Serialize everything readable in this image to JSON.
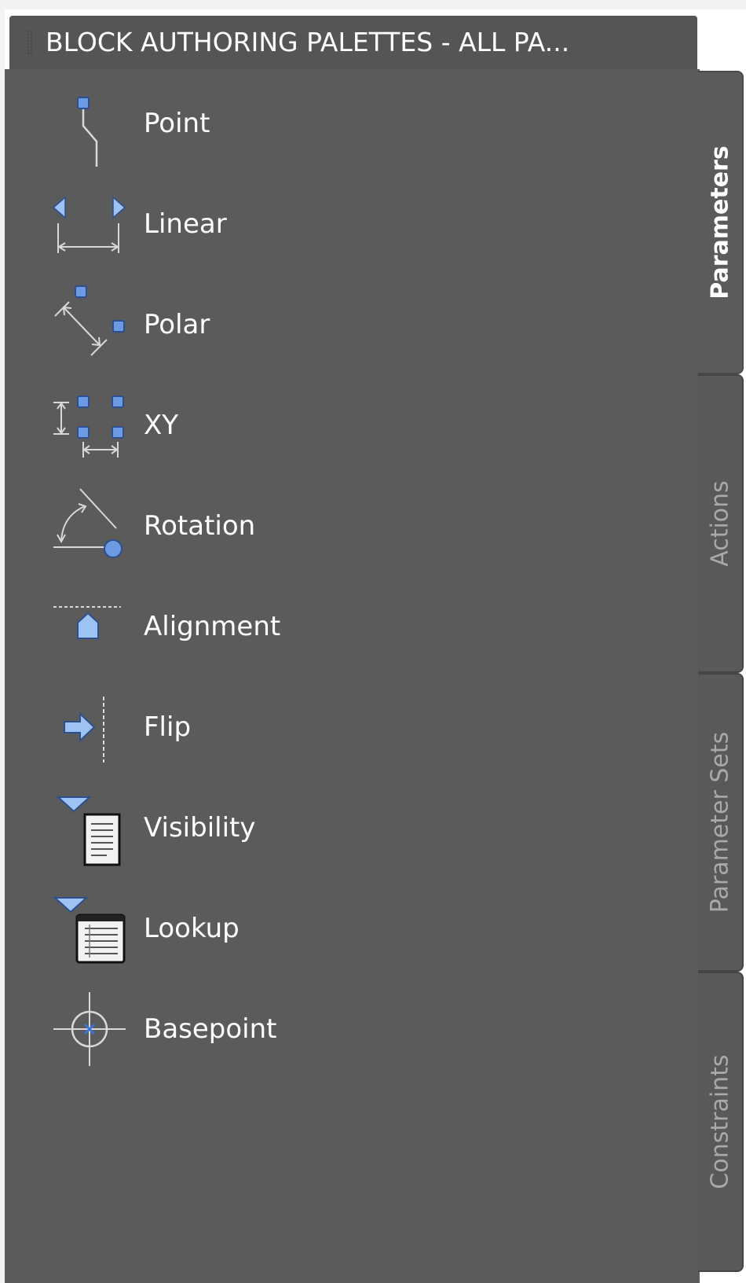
{
  "palette": {
    "title": "BLOCK AUTHORING PALETTES - ALL PA..."
  },
  "items": [
    {
      "label": "Point",
      "icon": "point-parameter-icon"
    },
    {
      "label": "Linear",
      "icon": "linear-parameter-icon"
    },
    {
      "label": "Polar",
      "icon": "polar-parameter-icon"
    },
    {
      "label": "XY",
      "icon": "xy-parameter-icon"
    },
    {
      "label": "Rotation",
      "icon": "rotation-parameter-icon"
    },
    {
      "label": "Alignment",
      "icon": "alignment-parameter-icon"
    },
    {
      "label": "Flip",
      "icon": "flip-parameter-icon"
    },
    {
      "label": "Visibility",
      "icon": "visibility-parameter-icon"
    },
    {
      "label": "Lookup",
      "icon": "lookup-parameter-icon"
    },
    {
      "label": "Basepoint",
      "icon": "basepoint-parameter-icon"
    }
  ],
  "tabs": [
    {
      "label": "Parameters",
      "active": true
    },
    {
      "label": "Actions",
      "active": false
    },
    {
      "label": "Parameter Sets",
      "active": false
    },
    {
      "label": "Constraints",
      "active": false
    }
  ],
  "colors": {
    "panel_bg": "#5b5b5b",
    "title_bg": "#555555",
    "grip_blue": "#6d9be3",
    "grip_dark": "#2c4f8f",
    "text": "#ffffff",
    "inactive_tab_text": "#a9a9a9"
  }
}
